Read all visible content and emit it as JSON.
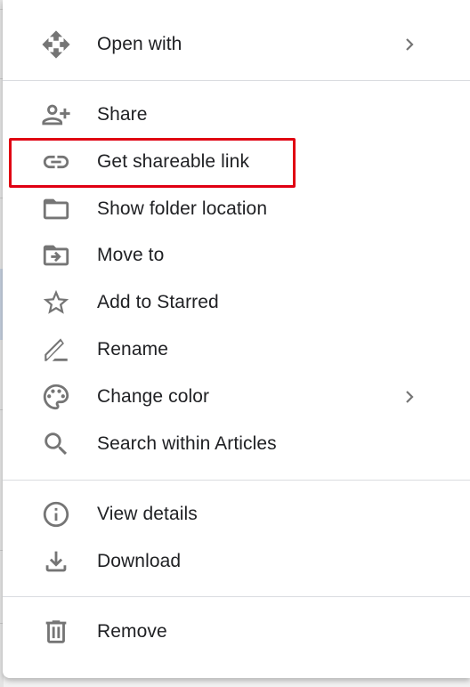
{
  "menu": {
    "groups": [
      {
        "items": [
          {
            "label": "Open with",
            "icon": "open-with-icon",
            "submenu": true
          }
        ]
      },
      {
        "items": [
          {
            "label": "Share",
            "icon": "person-add-icon",
            "submenu": false
          },
          {
            "label": "Get shareable link",
            "icon": "link-icon",
            "submenu": false,
            "highlighted": true
          },
          {
            "label": "Show folder location",
            "icon": "folder-icon",
            "submenu": false
          },
          {
            "label": "Move to",
            "icon": "move-to-folder-icon",
            "submenu": false
          },
          {
            "label": "Add to Starred",
            "icon": "star-outline-icon",
            "submenu": false
          },
          {
            "label": "Rename",
            "icon": "pencil-icon",
            "submenu": false
          },
          {
            "label": "Change color",
            "icon": "palette-icon",
            "submenu": true
          },
          {
            "label": "Search within Articles",
            "icon": "search-icon",
            "submenu": false
          }
        ]
      },
      {
        "items": [
          {
            "label": "View details",
            "icon": "info-icon",
            "submenu": false
          },
          {
            "label": "Download",
            "icon": "download-icon",
            "submenu": false
          }
        ]
      },
      {
        "items": [
          {
            "label": "Remove",
            "icon": "trash-icon",
            "submenu": false
          }
        ]
      }
    ]
  },
  "annotation": {
    "highlight_color": "#e00012",
    "highlighted_item": "Get shareable link"
  },
  "colors": {
    "icon": "#757575",
    "text": "#202124",
    "divider": "#dadce0"
  }
}
